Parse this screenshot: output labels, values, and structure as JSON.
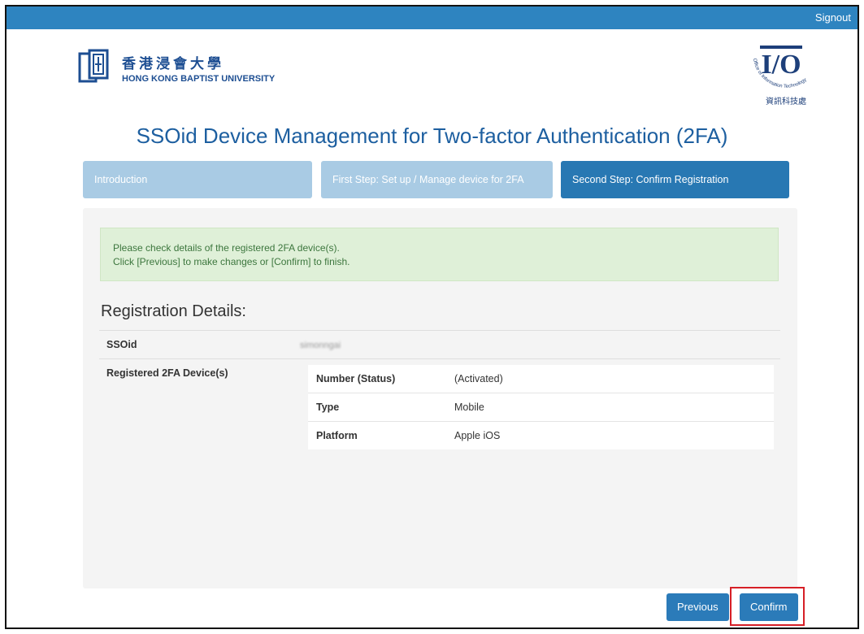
{
  "header": {
    "signout_label": "Signout"
  },
  "logo_left": {
    "chinese": "香港浸會大學",
    "english": "HONG KONG BAPTIST UNIVERSITY"
  },
  "logo_right": {
    "mark": "I/O",
    "arc_text": "Office of Information Technology",
    "chinese": "資訊科技處"
  },
  "page_title": "SSOid Device Management for Two-factor Authentication (2FA)",
  "steps": [
    {
      "label": "Introduction",
      "state": "inactive"
    },
    {
      "label": "First Step: Set up / Manage device for 2FA",
      "state": "inactive"
    },
    {
      "label": "Second Step: Confirm Registration",
      "state": "active"
    }
  ],
  "alert": {
    "line1": "Please check details of the registered 2FA device(s).",
    "line2": "Click [Previous] to make changes or [Confirm] to finish."
  },
  "details": {
    "title": "Registration Details:",
    "ssoid_label": "SSOid",
    "ssoid_value": "simonngai",
    "devices_label": "Registered 2FA Device(s)",
    "device": [
      {
        "key": "Number (Status)",
        "value": "(Activated)"
      },
      {
        "key": "Type",
        "value": "Mobile"
      },
      {
        "key": "Platform",
        "value": "Apple iOS"
      }
    ]
  },
  "buttons": {
    "previous": "Previous",
    "confirm": "Confirm"
  },
  "colors": {
    "topbar": "#2e84c0",
    "step_active": "#2878b3",
    "step_inactive": "#a9cbe4",
    "alert_bg": "#dff0d8",
    "alert_text": "#3c763d",
    "button": "#2b7bb9",
    "highlight": "#d61f26"
  },
  "icons": {
    "left_logo": "hkbu-book-logo-icon",
    "right_logo": "ito-logo-icon"
  }
}
